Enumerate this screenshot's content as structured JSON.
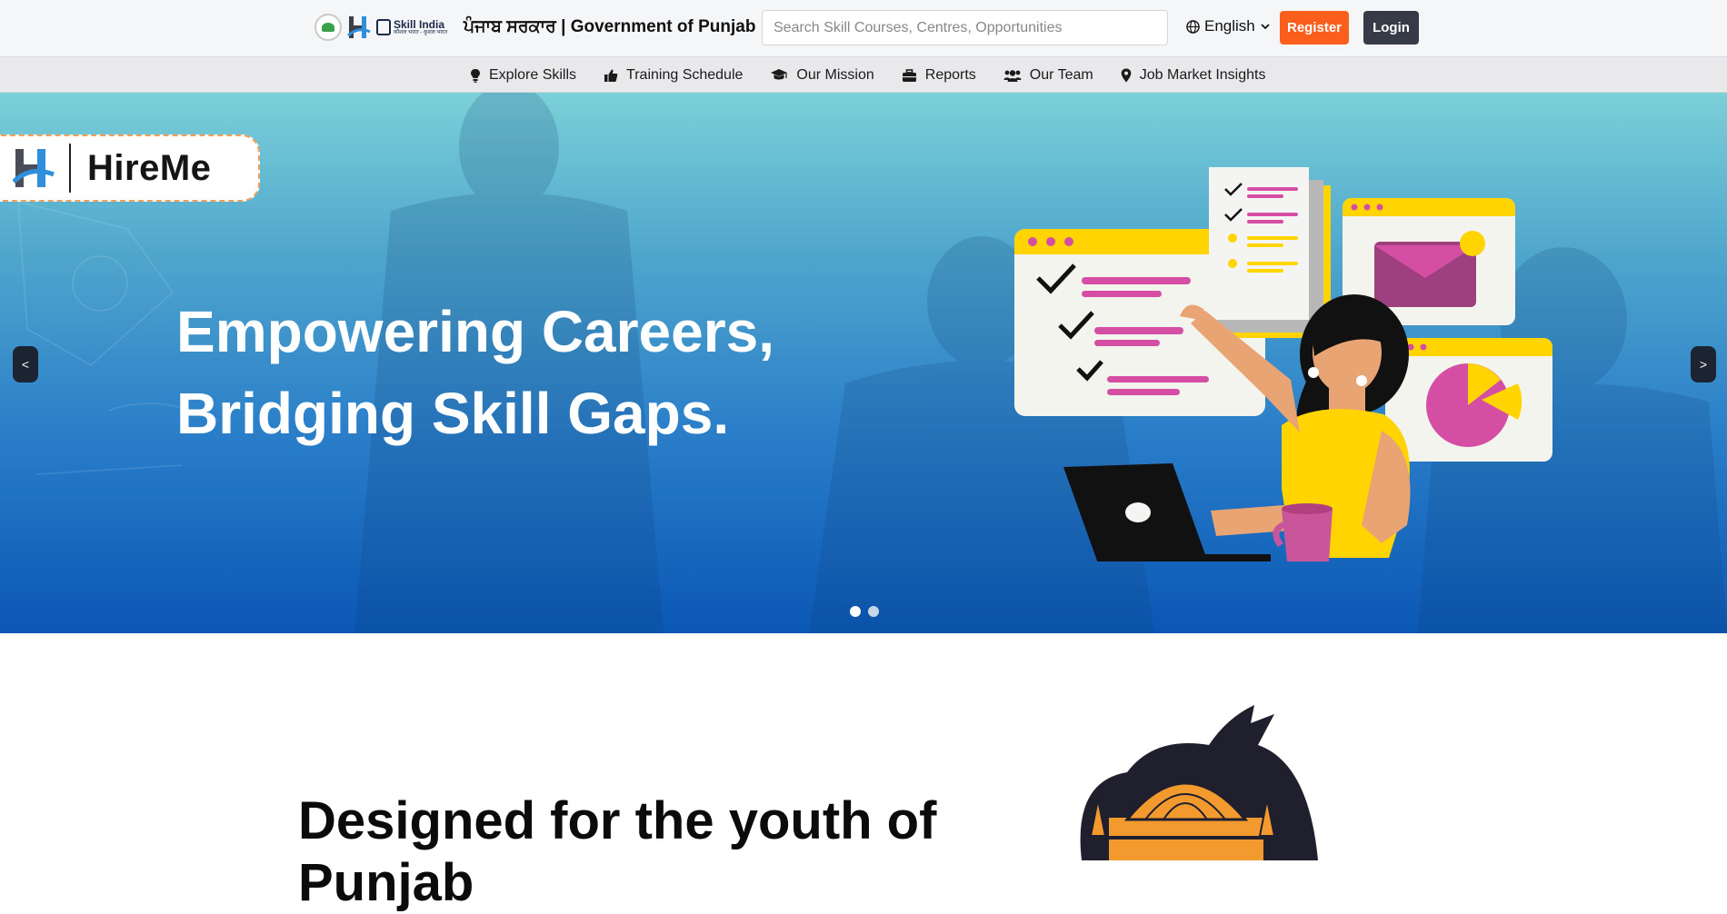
{
  "header": {
    "gov_title": "ਪੰਜਾਬ ਸਰਕਾਰ | Government of Punjab",
    "skill_india_line1": "Skill India",
    "skill_india_line2": "कौशल भारत - कुशल भारत",
    "search_placeholder": "Search Skill Courses, Centres, Opportunities",
    "language": "English",
    "register_label": "Register",
    "login_label": "Login"
  },
  "nav": {
    "items": [
      {
        "label": "Explore Skills",
        "icon": "lightbulb-icon"
      },
      {
        "label": "Training Schedule",
        "icon": "thumbs-up-icon"
      },
      {
        "label": "Our Mission",
        "icon": "graduation-cap-icon"
      },
      {
        "label": "Reports",
        "icon": "briefcase-icon"
      },
      {
        "label": "Our Team",
        "icon": "users-icon"
      },
      {
        "label": "Job Market Insights",
        "icon": "map-pin-icon"
      }
    ]
  },
  "hero": {
    "brand": "HireMe",
    "headline_line1": "Empowering Careers,",
    "headline_line2": "Bridging Skill Gaps.",
    "prev_label": "<",
    "next_label": ">",
    "slide_count": 2,
    "active_slide": 1
  },
  "section": {
    "title": "Designed for the youth of Punjab"
  },
  "colors": {
    "register": "#fa5f1c",
    "login": "#373b48",
    "hero_top": "#7bd0d8",
    "hero_bottom": "#0a57b5",
    "accent_yellow": "#ffd400",
    "accent_pink": "#d44fa3"
  }
}
